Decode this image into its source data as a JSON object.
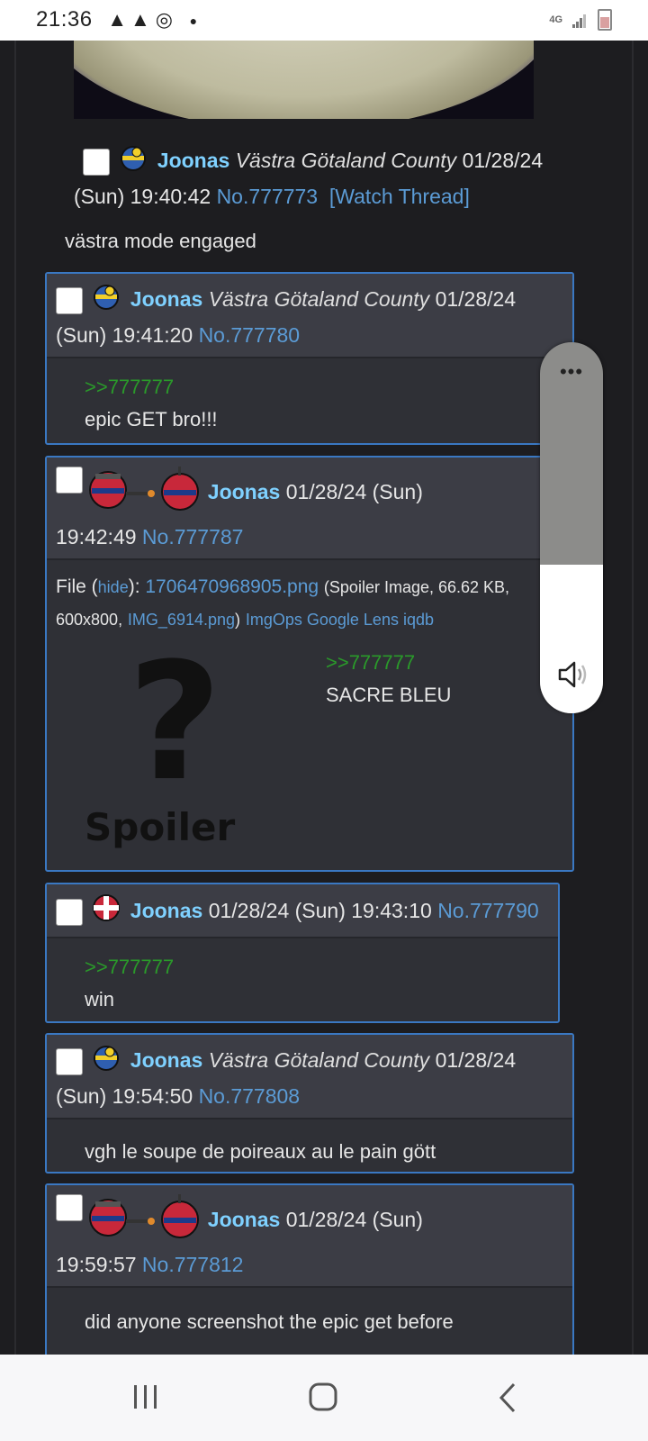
{
  "status_bar": {
    "time": "21:36",
    "network": "4G",
    "icons": [
      "alert-icon",
      "alert-icon",
      "chrome-icon",
      "dot-icon",
      "signal-icon",
      "battery-icon"
    ]
  },
  "op_post": {
    "name": "Joonas",
    "location": "Västra Götaland County",
    "date": "01/28/24",
    "day_time": "(Sun) 19:40:42",
    "number": "No.777773",
    "watch": "[Watch Thread]",
    "message": "västra mode engaged"
  },
  "posts": [
    {
      "name": "Joonas",
      "location": "Västra Götaland County",
      "date": "01/28/24",
      "day_time": "(Sun) 19:41:20",
      "number": "No.777780",
      "quote": ">>777777",
      "message": "epic GET bro!!!"
    },
    {
      "name": "Joonas",
      "date_day": "01/28/24 (Sun)",
      "time": "19:42:49",
      "number": "No.777787",
      "file_label": "File (",
      "hide": "hide",
      "file_label_end": "):",
      "file_name": "1706470968905.png",
      "file_meta": "(Spoiler Image, 66.62 KB,",
      "dims": "600x800,",
      "orig_name": "IMG_6914.png",
      "file_meta_end": ")",
      "tools": "ImgOps Google Lens iqdb",
      "spoiler_q": "?",
      "spoiler_text": "Spoiler",
      "quote": ">>777777",
      "message": "SACRE BLEU"
    },
    {
      "name": "Joonas",
      "date_day": "01/28/24 (Sun) 19:43:10",
      "number": "No.777790",
      "quote": ">>777777",
      "message": "win"
    },
    {
      "name": "Joonas",
      "location": "Västra Götaland County",
      "date": "01/28/24",
      "day_time": "(Sun) 19:54:50",
      "number": "No.777808",
      "message": "vgh le soupe de poireaux au le pain gött"
    },
    {
      "name": "Joonas",
      "date_day": "01/28/24 (Sun)",
      "time": "19:59:57",
      "number": "No.777812",
      "message": "did anyone screenshot the epic get before"
    }
  ],
  "volume_panel": {
    "level": 0.4,
    "more": "•••"
  },
  "colors": {
    "name": "#7fd1ff",
    "link": "#5b9bd5",
    "quote": "#2a9a2a",
    "border": "#3a78c2"
  }
}
